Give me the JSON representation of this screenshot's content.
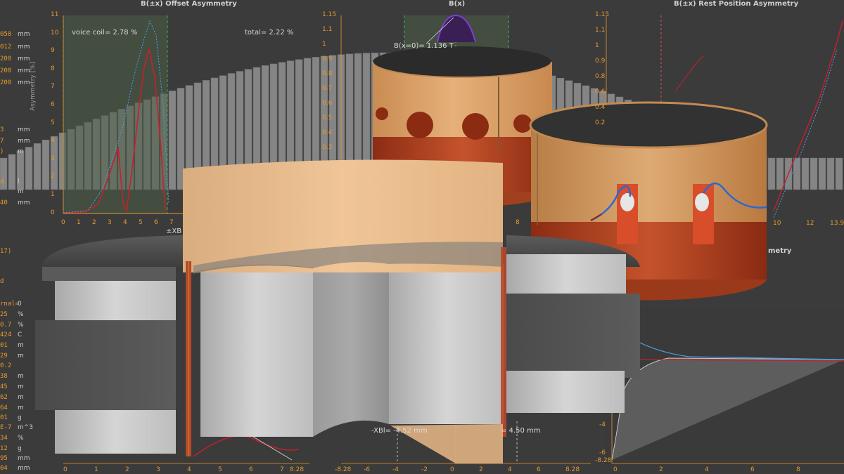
{
  "plots": {
    "left_title": "B(±x) Offset Asymmetry",
    "center_title": "B(x)",
    "right_title": "B(±x) Rest Position Asymmetry",
    "right_lower_title": "metry"
  },
  "annotations": {
    "voice_coil": "voice coil= 2.78 %",
    "total": "total= 2.22 %",
    "bx0": "B(x=0)= 1.136 T",
    "xbl_neg": "-XBl= -4.52 mm",
    "xbl_pos": "= 4.50 mm",
    "xb_label": "±XB",
    "asym_axis": "Asymmetry [%]"
  },
  "axes": {
    "left_y": [
      "11",
      "10",
      "9",
      "8",
      "7",
      "6",
      "5",
      "4",
      "3",
      "2",
      "1",
      "0"
    ],
    "left_x": [
      "0",
      "1",
      "2",
      "3",
      "4",
      "5",
      "6",
      "7"
    ],
    "left_x_bottom": [
      "0",
      "1",
      "2",
      "3",
      "4",
      "5",
      "6",
      "7",
      "8.28"
    ],
    "center_y": [
      "1.15",
      "1.1",
      "1",
      "0.9",
      "0.8",
      "0.7",
      "0.6",
      "0.5",
      "0.4",
      "0.3"
    ],
    "center_x": [
      "-8.28",
      "-6",
      "-4",
      "-2",
      "0",
      "2",
      "4",
      "6",
      "8.28"
    ],
    "right_y": [
      "1.15",
      "1.1",
      "1",
      "0.9",
      "0.8",
      "0.6",
      "0.4",
      "0.2"
    ],
    "right_x": [
      "10",
      "12",
      "13.9"
    ],
    "right_lower_y": [
      "-4",
      "-6",
      "-8.28"
    ],
    "right_lower_x": [
      "0",
      "2",
      "4",
      "6",
      "8"
    ],
    "center_small_x": [
      "8"
    ]
  },
  "left_panel": [
    {
      "value": "050",
      "unit": "mm"
    },
    {
      "value": "012",
      "unit": "mm"
    },
    {
      "value": "200",
      "unit": "mm"
    },
    {
      "value": "200",
      "unit": "mm"
    },
    {
      "value": "200",
      "unit": "mm"
    },
    {
      "value": "3",
      "unit": "mm"
    },
    {
      "value": "7",
      "unit": "mm"
    },
    {
      "value": ")",
      "unit": "m"
    },
    {
      "value": "d",
      "unit": "l"
    },
    {
      "value": "",
      "unit": "m"
    },
    {
      "value": "40",
      "unit": "mm"
    },
    {
      "value": "17)",
      "unit": ""
    },
    {
      "value": "d",
      "unit": ""
    },
    {
      "value": "rnal=",
      "unit": "0"
    },
    {
      "value": "25",
      "unit": "%"
    },
    {
      "value": "0.7",
      "unit": "%"
    },
    {
      "value": "424",
      "unit": "C"
    },
    {
      "value": "01",
      "unit": "m"
    },
    {
      "value": "29",
      "unit": "m"
    },
    {
      "value": "0.2",
      "unit": ""
    },
    {
      "value": "38",
      "unit": "m"
    },
    {
      "value": "45",
      "unit": "m"
    },
    {
      "value": "62",
      "unit": "m"
    },
    {
      "value": "64",
      "unit": "m"
    },
    {
      "value": "01",
      "unit": "g"
    },
    {
      "value": "E-7",
      "unit": "m^3"
    },
    {
      "value": "34",
      "unit": "%"
    },
    {
      "value": "12",
      "unit": "g"
    },
    {
      "value": "95",
      "unit": "mm"
    },
    {
      "value": "04",
      "unit": "mm"
    }
  ],
  "colors": {
    "background": "#3b3b3b",
    "accent": "#e69a2c",
    "curve_red": "#c8202c",
    "curve_blue": "#4aa3e8",
    "paper": "#d8a56d",
    "coil_copper": "#b5492a",
    "steel": "#c7c7c7",
    "magnet": "#555555",
    "wire_blue": "#2b67d6"
  },
  "icons": {
    "coil_former": "voice-coil-former",
    "magnet_assembly": "magnet-motor-cross-section"
  }
}
